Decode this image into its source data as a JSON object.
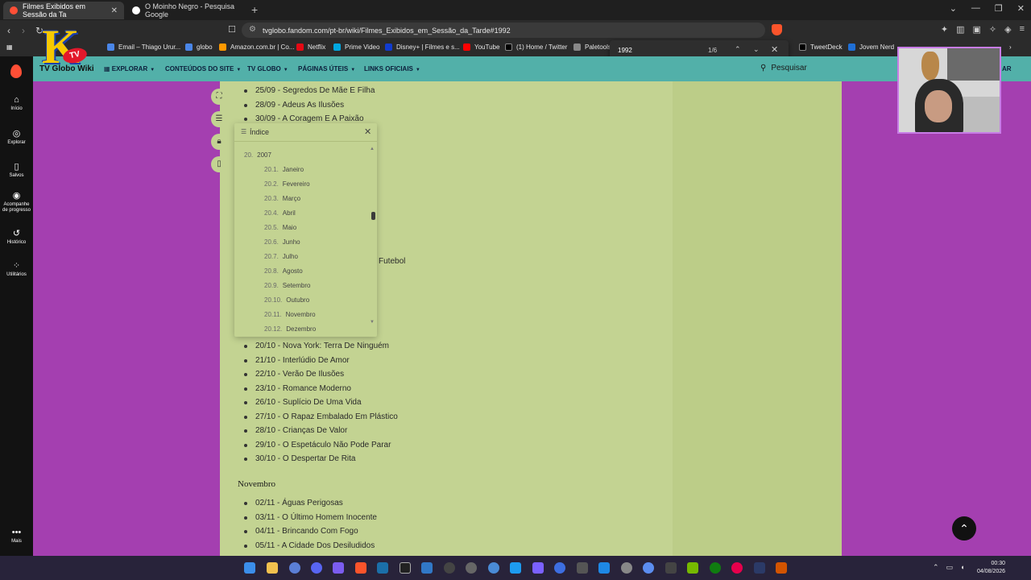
{
  "browser": {
    "tabs": [
      {
        "title": "Filmes Exibidos em Sessão da Ta",
        "active": true
      },
      {
        "title": "O Moinho Negro - Pesquisa Google",
        "active": false
      }
    ],
    "new_tab_symbol": "+",
    "url": "tvglobo.fandom.com/pt-br/wiki/Filmes_Exibidos_em_Sessão_da_Tarde#1992",
    "bookmarks": [
      {
        "label": "Email – Thiago Urur...",
        "color": "#4a86e8"
      },
      {
        "label": "globo",
        "color": "#4a86e8"
      },
      {
        "label": "Amazon.com.br | Co...",
        "color": "#ff9900"
      },
      {
        "label": "Netflix",
        "color": "#e50914"
      },
      {
        "label": "Prime Video",
        "color": "#00a8e1"
      },
      {
        "label": "Disney+ | Filmes e s...",
        "color": "#113ccf"
      },
      {
        "label": "YouTube",
        "color": "#ff0000"
      },
      {
        "label": "(1) Home / Twitter",
        "color": "#000000"
      },
      {
        "label": "Paletools",
        "color": "#888888"
      },
      {
        "label": "TweetDeck",
        "color": "#000000"
      },
      {
        "label": "Jovem Nerd",
        "color": "#1f6fd6"
      }
    ],
    "find": {
      "query": "1992",
      "count": "1/6"
    }
  },
  "wiki": {
    "name": "TV Globo Wiki",
    "nav": [
      "EXPLORAR",
      "CONTEÚDOS DO SITE",
      "TV GLOBO",
      "PÁGINAS ÚTEIS",
      "LINKS OFICIAIS"
    ],
    "search_label": "Pesquisar",
    "signin_fragment": "AR"
  },
  "rail": [
    {
      "icon": "home-icon",
      "label": "Início"
    },
    {
      "icon": "compass-icon",
      "label": "Explorar"
    },
    {
      "icon": "bookmark-icon",
      "label": "Salvos"
    },
    {
      "icon": "progress-icon",
      "label": "Acompanhe de progresso"
    },
    {
      "icon": "history-icon",
      "label": "Histórico"
    },
    {
      "icon": "tools-icon",
      "label": "Utilitários"
    },
    {
      "icon": "more-icon",
      "label": "Mais"
    }
  ],
  "article": {
    "top_items": [
      "25/09 - Segredos De Mãe E Filha",
      "28/09 - Adeus As Ilusões",
      "30/09 - A Coragem E A Paixão"
    ],
    "futebol_fragment": "Futebol",
    "october_items": [
      "20/10 - Nova York: Terra De Ninguém",
      "21/10 - Interlúdio De Amor",
      "22/10 - Verão De Ilusões",
      "23/10 - Romance Moderno",
      "26/10 - Suplício De Uma Vida",
      "27/10 - O Rapaz Embalado Em Plástico",
      "28/10 - Crianças De Valor",
      "29/10 - O Espetáculo Não Pode Parar",
      "30/10 - O Despertar De Rita"
    ],
    "november_heading": "Novembro",
    "november_items": [
      "02/11 - Águas Perigosas",
      "03/11 - O Último Homem Inocente",
      "04/11 - Brincando Com Fogo",
      "05/11 - A Cidade Dos Desiludidos"
    ]
  },
  "toc": {
    "title": "Índice",
    "section": {
      "num": "20.",
      "label": "2007"
    },
    "items": [
      {
        "num": "20.1.",
        "label": "Janeiro"
      },
      {
        "num": "20.2.",
        "label": "Fevereiro"
      },
      {
        "num": "20.3.",
        "label": "Março"
      },
      {
        "num": "20.4.",
        "label": "Abril"
      },
      {
        "num": "20.5.",
        "label": "Maio"
      },
      {
        "num": "20.6.",
        "label": "Junho"
      },
      {
        "num": "20.7.",
        "label": "Julho"
      },
      {
        "num": "20.8.",
        "label": "Agosto"
      },
      {
        "num": "20.9.",
        "label": "Setembro"
      },
      {
        "num": "20.10.",
        "label": "Outubro"
      },
      {
        "num": "20.11.",
        "label": "Novembro"
      },
      {
        "num": "20.12.",
        "label": "Dezembro"
      }
    ]
  },
  "overlay": {
    "logo_letter": "K",
    "logo_badge": "TV"
  },
  "taskbar": {
    "time": "00:30",
    "date": "04/08/2026"
  },
  "colors": {
    "page_bg": "#a43fb0",
    "article_bg": "#c3d392",
    "header_bg": "#52b0a9",
    "accent": "#ff4f36"
  }
}
